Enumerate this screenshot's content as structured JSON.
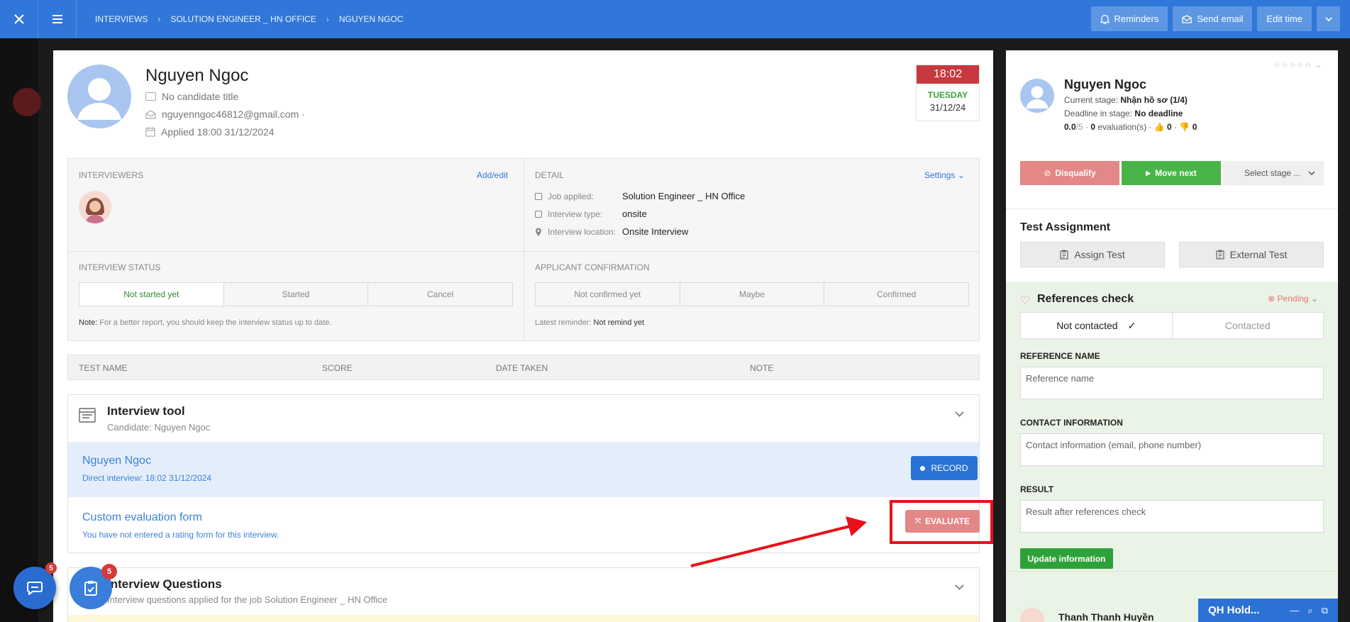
{
  "topbar": {
    "breadcrumbs": [
      "INTERVIEWS",
      "SOLUTION ENGINEER _ HN OFFICE",
      "NGUYEN NGOC"
    ],
    "reminders": "Reminders",
    "send_email": "Send email",
    "edit_time": "Edit time"
  },
  "candidate": {
    "name": "Nguyen Ngoc",
    "title": "No candidate title",
    "email": "nguyenngoc46812@gmail.com ·",
    "applied": "Applied 18:00 31/12/2024"
  },
  "datebox": {
    "time": "18:02",
    "day": "TUESDAY",
    "date": "31/12/24"
  },
  "interviewers": {
    "title": "INTERVIEWERS",
    "link": "Add/edit"
  },
  "detail": {
    "title": "DETAIL",
    "settings": "Settings",
    "rows": [
      {
        "label": "Job applied:",
        "value": "Solution Engineer _ HN Office"
      },
      {
        "label": "Interview type:",
        "value": "onsite"
      },
      {
        "label": "Interview location:",
        "value": "Onsite Interview"
      }
    ]
  },
  "interview_status": {
    "title": "INTERVIEW STATUS",
    "options": [
      "Not started yet",
      "Started",
      "Cancel"
    ],
    "note_label": "Note:",
    "note": " For a better report, you should keep the interview status up to date."
  },
  "applicant_confirmation": {
    "title": "APPLICANT CONFIRMATION",
    "options": [
      "Not confirmed yet",
      "Maybe",
      "Confirmed"
    ],
    "reminder_label": "Latest reminder:",
    "reminder": " Not remind yet"
  },
  "tests_table": {
    "columns": [
      "TEST NAME",
      "SCORE",
      "DATE TAKEN",
      "NOTE"
    ]
  },
  "interview_tool": {
    "title": "Interview tool",
    "subtitle": "Candidate: Nguyen Ngoc",
    "session_name": "Nguyen Ngoc",
    "session_sub": "Direct interview: 18:02 31/12/2024",
    "record": "RECORD",
    "form_name": "Custom evaluation form",
    "form_sub": "You have not entered a rating form for this interview.",
    "evaluate": "EVALUATE"
  },
  "questions": {
    "title": "Interview Questions",
    "subtitle": "Interview questions applied for the job Solution Engineer _ HN Office"
  },
  "right_panel": {
    "name": "Nguyen Ngoc",
    "stage_label": "Current stage: ",
    "stage": "Nhận hồ sơ (1/4)",
    "deadline_label": "Deadline in stage: ",
    "deadline": "No deadline",
    "score": "0.0",
    "score_of": "/5 · ",
    "evals": "0",
    "evals_label": " evaluation(s) · ",
    "likes": "0",
    "dislikes": "0",
    "disqualify": "Disqualify",
    "move_next": "Move next",
    "select_stage": "Select stage ..."
  },
  "test_assignment": {
    "title": "Test Assignment",
    "assign": "Assign Test",
    "external": "External Test"
  },
  "references": {
    "title": "References check",
    "status": "Pending",
    "not_contacted": "Not contacted",
    "contacted": "Contacted",
    "name_label": "REFERENCE NAME",
    "name_placeholder": "Reference name",
    "contact_label": "CONTACT INFORMATION",
    "contact_placeholder": "Contact information (email, phone number)",
    "result_label": "RESULT",
    "result_placeholder": "Result after references check",
    "update": "Update information",
    "person": "Thanh Thanh Huyền"
  },
  "floating": {
    "chat_badge": "5",
    "task_badge": "5",
    "qh_title": "QH Hold..."
  },
  "colors": {
    "primary": "#3077d9",
    "danger": "#c8383f",
    "success": "#49b549",
    "highlight": "#e8101a"
  }
}
